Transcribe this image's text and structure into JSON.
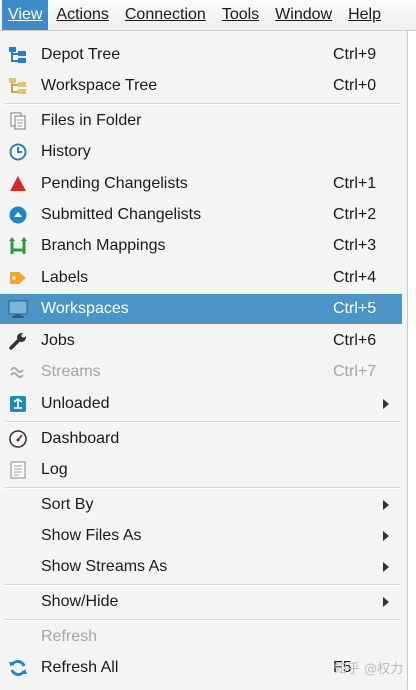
{
  "menubar": {
    "items": [
      {
        "label": "View",
        "underline": "V",
        "active": true
      },
      {
        "label": "Actions"
      },
      {
        "label": "Connection"
      },
      {
        "label": "Tools"
      },
      {
        "label": "Window"
      },
      {
        "label": "Help"
      }
    ]
  },
  "view_menu": {
    "items": [
      {
        "label": "Depot Tree",
        "shortcut": "Ctrl+9",
        "icon": "depot-tree-icon"
      },
      {
        "label": "Workspace Tree",
        "shortcut": "Ctrl+0",
        "icon": "workspace-tree-icon"
      },
      {
        "label": "Files in Folder",
        "icon": "files-in-folder-icon"
      },
      {
        "label": "History",
        "icon": "history-clock-icon"
      },
      {
        "label": "Pending Changelists",
        "shortcut": "Ctrl+1",
        "icon": "pending-changelist-icon"
      },
      {
        "label": "Submitted Changelists",
        "shortcut": "Ctrl+2",
        "icon": "submitted-changelist-icon"
      },
      {
        "label": "Branch Mappings",
        "shortcut": "Ctrl+3",
        "icon": "branch-mapping-icon"
      },
      {
        "label": "Labels",
        "shortcut": "Ctrl+4",
        "icon": "label-tag-icon"
      },
      {
        "label": "Workspaces",
        "shortcut": "Ctrl+5",
        "icon": "workspace-monitor-icon",
        "highlighted": true
      },
      {
        "label": "Jobs",
        "shortcut": "Ctrl+6",
        "icon": "jobs-wrench-icon"
      },
      {
        "label": "Streams",
        "shortcut": "Ctrl+7",
        "icon": "streams-icon",
        "disabled": true
      },
      {
        "label": "Unloaded",
        "icon": "unloaded-icon",
        "submenu": true
      },
      {
        "label": "Dashboard",
        "icon": "dashboard-gauge-icon"
      },
      {
        "label": "Log",
        "icon": "log-icon"
      },
      {
        "label": "Sort By",
        "submenu": true
      },
      {
        "label": "Show Files As",
        "submenu": true
      },
      {
        "label": "Show Streams As",
        "submenu": true
      },
      {
        "label": "Show/Hide",
        "submenu": true
      },
      {
        "label": "Refresh",
        "disabled": true
      },
      {
        "label": "Refresh All",
        "shortcut": "F5",
        "icon": "refresh-all-icon"
      }
    ]
  },
  "colors": {
    "highlight": "#4c93c6",
    "menubar_active": "#3d8bc7",
    "disabled_text": "#a5a5a5"
  },
  "watermark": "知乎 @权力"
}
